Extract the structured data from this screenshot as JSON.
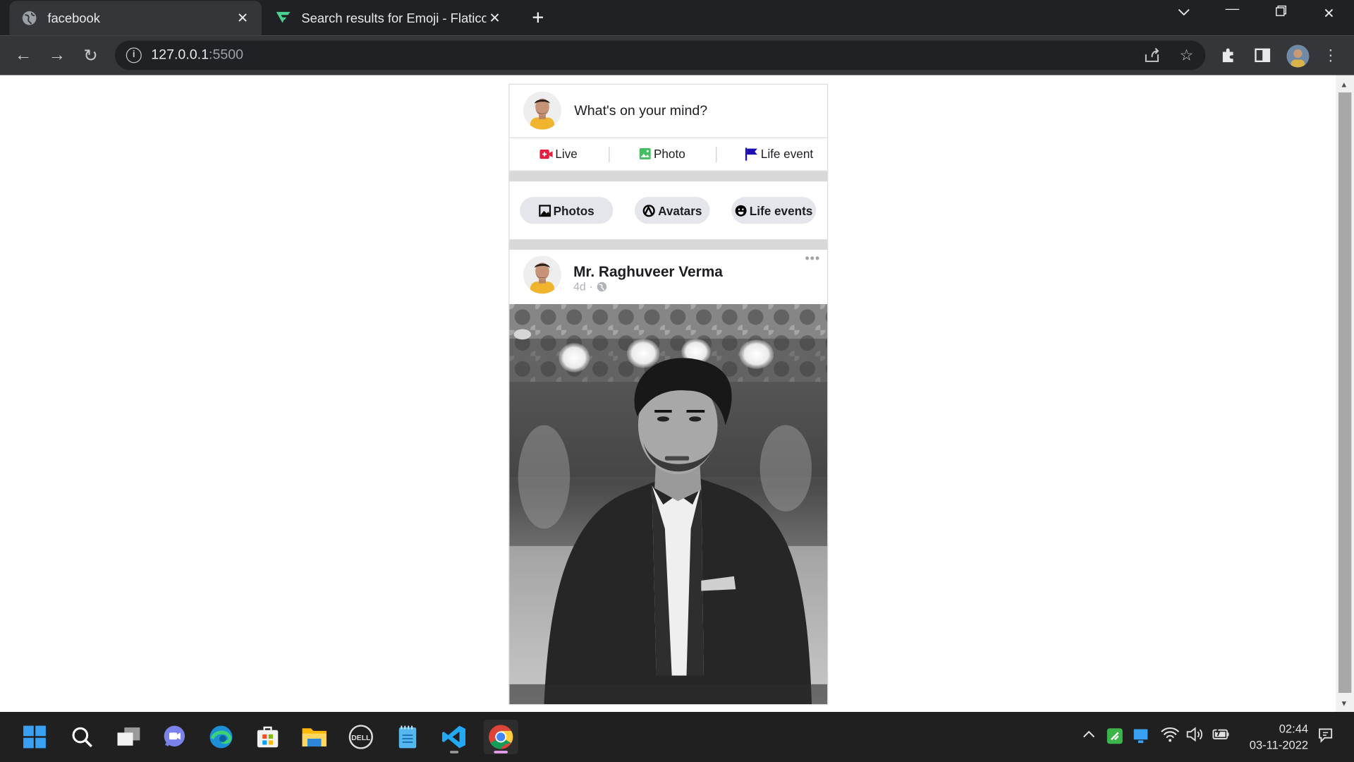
{
  "browser": {
    "tabs": [
      {
        "title": "facebook",
        "active": true,
        "favicon": "globe-icon"
      },
      {
        "title": "Search results for Emoji - Flaticon",
        "active": false,
        "favicon": "flaticon-logo-icon"
      }
    ],
    "url_host": "127.0.0.1",
    "url_port": ":5500"
  },
  "composer": {
    "prompt": "What's on your mind?",
    "actions": [
      {
        "label": "Live",
        "icon": "live-video-icon",
        "color": "#e41e3f"
      },
      {
        "label": "Photo",
        "icon": "photo-icon",
        "color": "#45bd62"
      },
      {
        "label": "Life event",
        "icon": "flag-icon",
        "color": "#1d0eb3"
      }
    ]
  },
  "chips": [
    {
      "label": "Photos",
      "icon": "image-icon"
    },
    {
      "label": "Avatars",
      "icon": "avatar-icon"
    },
    {
      "label": "Life events",
      "icon": "smile-icon"
    }
  ],
  "post": {
    "author": "Mr. Raghuveer Verma",
    "time": "4d",
    "audience_icon": "globe-icon",
    "more": "•••"
  },
  "taskbar": {
    "apps": [
      "start-icon",
      "search-icon",
      "task-view-icon",
      "chat-icon",
      "edge-icon",
      "store-icon",
      "file-explorer-icon",
      "dell-icon",
      "notepad-icon",
      "vscode-icon",
      "chrome-icon"
    ],
    "time": "02:44",
    "date": "03-11-2022"
  }
}
